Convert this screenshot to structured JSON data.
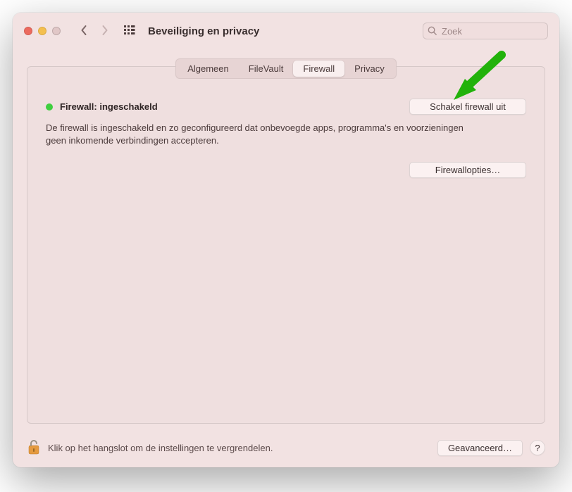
{
  "window": {
    "title": "Beveiliging en privacy"
  },
  "search": {
    "placeholder": "Zoek"
  },
  "tabs": {
    "items": [
      {
        "label": "Algemeen"
      },
      {
        "label": "FileVault"
      },
      {
        "label": "Firewall"
      },
      {
        "label": "Privacy"
      }
    ],
    "active_index": 2
  },
  "firewall": {
    "status_label": "Firewall: ingeschakeld",
    "status_color": "#3fcf3f",
    "disable_button": "Schakel firewall uit",
    "description": "De firewall is ingeschakeld en zo geconfigureerd dat onbevoegde apps, programma's en voorzieningen geen inkomende verbindingen accepteren.",
    "options_button": "Firewallopties…"
  },
  "footer": {
    "lock_hint": "Klik op het hangslot om de instellingen te vergrendelen.",
    "advanced_button": "Geavanceerd…",
    "help_label": "?"
  },
  "icons": {
    "search": "search-icon",
    "grid": "grid-icon",
    "back": "chevron-left-icon",
    "forward": "chevron-right-icon",
    "lock": "lock-open-icon",
    "status_dot": "status-dot-icon",
    "arrow_annotation": "arrow-annotation"
  }
}
